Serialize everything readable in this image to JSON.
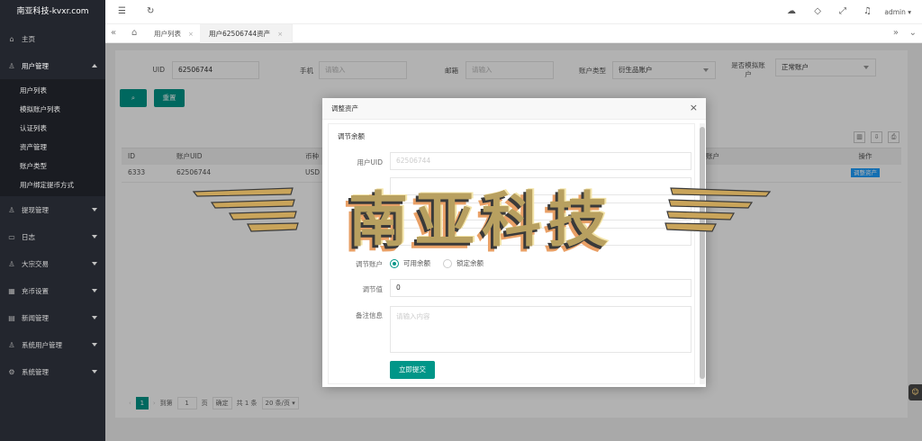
{
  "app": {
    "title": "南亚科技-kvxr.com",
    "user": "admin"
  },
  "sidebar": {
    "home": "主页",
    "user_mgmt": "用户管理",
    "user_sub": [
      "用户列表",
      "模拟账户列表",
      "认证列表",
      "资产管理",
      "账户类型",
      "用户绑定提币方式"
    ],
    "items": [
      "提现管理",
      "日志",
      "大宗交易",
      "充币设置",
      "新闻管理",
      "系统用户管理",
      "系统管理"
    ]
  },
  "tabs": {
    "list": "用户列表",
    "assets": "用户62506744资产",
    "close": "×"
  },
  "filters": {
    "uid_label": "UID",
    "uid_value": "62506744",
    "phone_label": "手机",
    "phone_placeholder": "请输入",
    "email_label": "邮箱",
    "email_placeholder": "请输入",
    "acct_type_label": "账户类型",
    "acct_type_value": "衍生品账户",
    "sim_label_1": "是否模拟账",
    "sim_label_2": "户",
    "sim_value": "正常账户",
    "reset": "重置"
  },
  "table": {
    "headers": [
      "ID",
      "账户UID",
      "币种",
      "",
      "",
      "",
      "",
      "",
      "",
      "模拟账户",
      "",
      "操作"
    ],
    "row": {
      "id": "6333",
      "uid": "62506744",
      "coin": "USD",
      "sim": "户",
      "action": "调整资产"
    }
  },
  "pager": {
    "page": "1",
    "goto": "到第",
    "page_input": "1",
    "page_unit": "页",
    "confirm": "确定",
    "total": "共 1 条",
    "per_page": "20 条/页"
  },
  "modal": {
    "title": "调整资产",
    "close": "×",
    "section": "调节余额",
    "uid_label": "用户UID",
    "uid_value": "62506744",
    "adjust_account_label": "调节账户",
    "radio_available": "可用余额",
    "radio_frozen": "锁定余额",
    "adjust_value_label": "调节值",
    "adjust_value": "0",
    "remark_label": "备注信息",
    "remark_placeholder": "请输入内容",
    "submit": "立即提交"
  },
  "watermark": "南亚科技"
}
